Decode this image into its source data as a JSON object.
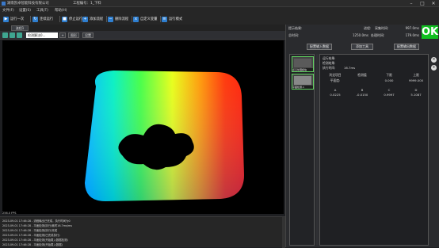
{
  "window": {
    "title": "湖南凯卓智能科技有限公司",
    "project_label": "工程编号：",
    "project_value": "1_下料",
    "minimize": "–",
    "maximize": "□",
    "close": "✕"
  },
  "menu": [
    "文件(F)",
    "设置(S)",
    "工具(T)",
    "帮助(H)"
  ],
  "toolbar": {
    "run_once": "运行一次",
    "continuous": "连续运行",
    "stop": "停止运行",
    "add_process": "添加流程",
    "delete_process": "删除流程",
    "custom_var": "自定义变量",
    "run_mode": "运行模式"
  },
  "tabs": [
    "流程1"
  ],
  "view": {
    "select_value": "检测算法0…",
    "btn_small": "+",
    "btn_image": "图形",
    "btn_settings": "设置"
  },
  "status_text": "256.0 FPS",
  "log": [
    "2023-09-01 17:46:28 - 流程输出已完成，执行时间为0",
    "2023-09-01 17:46:28 - 平面检测(执行)耗时16.7ms/ms",
    "2023-09-01 17:46:28 - 平面检测(执行)完成",
    "2023-09-01 17:46:28 - 平面检测(已完成执行)",
    "2023-09-01 17:46:28 - 平面检测(开始载入数据检测)",
    "2023-09-01 17:46:28 - 平面检测(开始载入数据)"
  ],
  "right": {
    "prompt_label": "提示结果:",
    "prompt_value": "",
    "trigger_label": "进程:",
    "trigger_value": "",
    "standard_label": "采集时间:",
    "standard_value": "997.0ms",
    "total_label": "总时间:",
    "total_value": "1250.0ms",
    "process_label": "处理时间:",
    "process_value": "179.0ms",
    "ok_text": "OK",
    "btn_load": "配置输入数据",
    "btn_add": "添加工具",
    "btn_output": "配置输出数据",
    "thumbs": [
      "点云处理模块",
      "平面检测.1"
    ],
    "info": {
      "run_result_label": "运行结果:",
      "run_result_value": "",
      "check_result_label": "检测结果:",
      "check_result_value": "",
      "exec_time_label": "执行时间:",
      "exec_time_value": "16.7ms",
      "col_judge": "判定项目",
      "col_measure": "检测值",
      "col_lower": "下限",
      "col_upper": "上限",
      "row_label": "平面度:",
      "row_measure": "",
      "row_lower": "0.000",
      "row_upper": "9999.000",
      "coef_headers": [
        "A",
        "B",
        "C",
        "D"
      ],
      "coef_values": [
        "0.0225",
        "-0.0150",
        "0.9997",
        "5.1087"
      ]
    }
  },
  "colors": {
    "ok": "#10c020",
    "accent_teal": "#3fa590",
    "bg": "#1e1f22"
  },
  "icons": [
    "play-icon",
    "loop-icon",
    "stop-icon",
    "add-icon",
    "delete-icon",
    "variable-icon",
    "mode-icon"
  ]
}
